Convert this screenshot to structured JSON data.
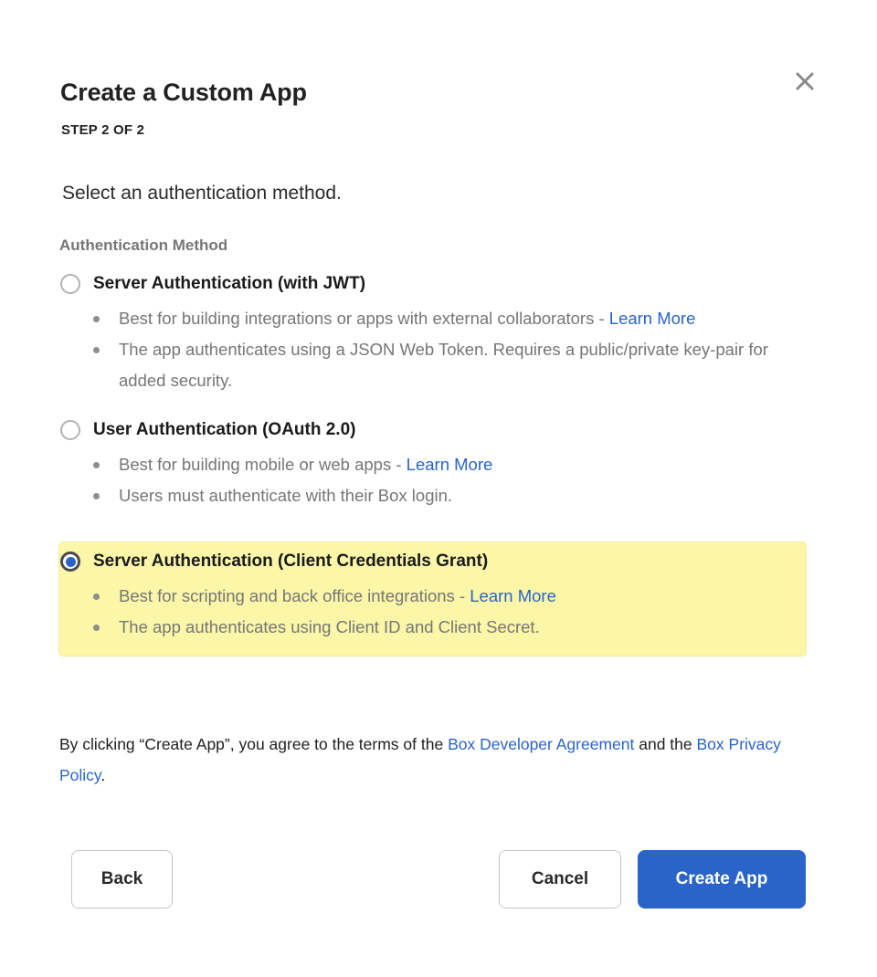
{
  "dialog": {
    "title": "Create a Custom App",
    "step": "STEP 2 OF 2",
    "subtitle": "Select an authentication method.",
    "close_icon": "close-icon"
  },
  "field": {
    "label": "Authentication Method"
  },
  "options": [
    {
      "id": "server-jwt",
      "title": "Server Authentication (with JWT)",
      "selected": false,
      "bullets": [
        {
          "text_before": "Best for building integrations or apps with external collaborators - ",
          "link": "Learn More",
          "text_after": ""
        },
        {
          "text_before": "The app authenticates using a JSON Web Token. Requires a public/private key-pair for added security.",
          "link": "",
          "text_after": ""
        }
      ]
    },
    {
      "id": "user-oauth",
      "title": "User Authentication (OAuth 2.0)",
      "selected": false,
      "bullets": [
        {
          "text_before": "Best for building mobile or web apps - ",
          "link": "Learn More",
          "text_after": ""
        },
        {
          "text_before": "Users must authenticate with their Box login.",
          "link": "",
          "text_after": ""
        }
      ]
    },
    {
      "id": "server-ccg",
      "title": "Server Authentication (Client Credentials Grant)",
      "selected": true,
      "bullets": [
        {
          "text_before": "Best for scripting and back office integrations - ",
          "link": "Learn More",
          "text_after": ""
        },
        {
          "text_before": "The app authenticates using Client ID and Client Secret.",
          "link": "",
          "text_after": ""
        }
      ]
    }
  ],
  "legal": {
    "part1": "By clicking “Create App”, you agree to the terms of the ",
    "link1": "Box Developer Agreement",
    "part2": " and the ",
    "link2": "Box Privacy Policy",
    "part3": "."
  },
  "footer": {
    "back_label": "Back",
    "cancel_label": "Cancel",
    "create_label": "Create App"
  },
  "colors": {
    "accent_blue": "#2a64c8",
    "link_blue": "#2a64c8",
    "highlight_yellow": "#fbf6a8",
    "muted_text": "#767676",
    "border_gray": "#c4c4c4"
  }
}
